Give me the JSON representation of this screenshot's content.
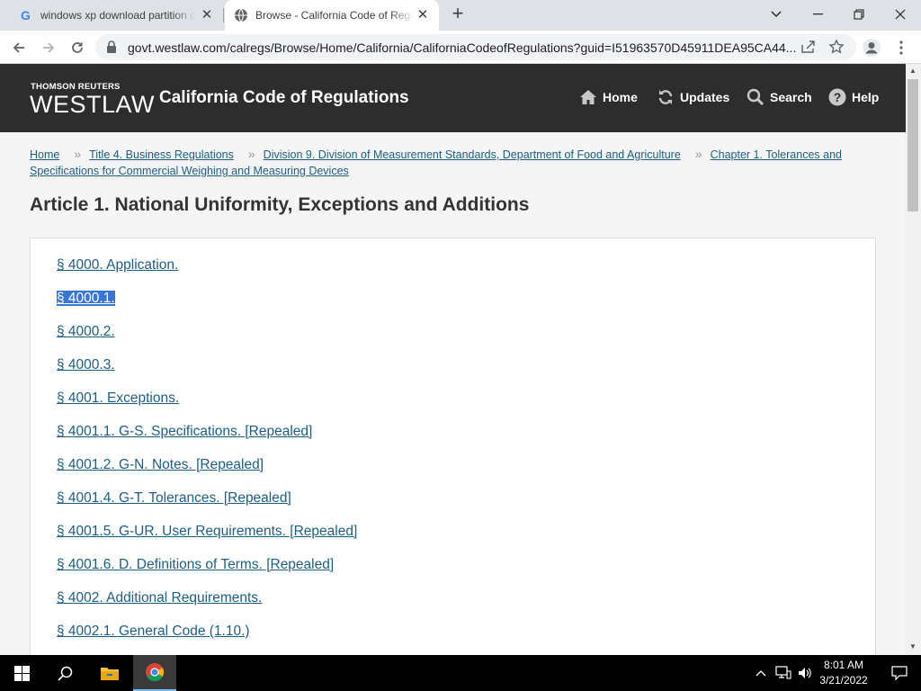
{
  "browser": {
    "tabs": [
      {
        "title": "windows xp download partition cr",
        "favicon": "google-icon",
        "active": false
      },
      {
        "title": "Browse - California Code of Regulations",
        "favicon": "globe-icon",
        "active": true
      }
    ],
    "url": "govt.westlaw.com/calregs/Browse/Home/California/CaliforniaCodeofRegulations?guid=I51963570D45911DEA95CA44..."
  },
  "header": {
    "brand_top": "THOMSON REUTERS",
    "brand_main": "WESTLAW",
    "site_title": "California Code of Regulations",
    "nav": [
      {
        "label": "Home",
        "icon": "home-icon"
      },
      {
        "label": "Updates",
        "icon": "refresh-icon"
      },
      {
        "label": "Search",
        "icon": "search-icon"
      },
      {
        "label": "Help",
        "icon": "help-icon"
      }
    ]
  },
  "breadcrumb": [
    "Home",
    "Title 4. Business Regulations",
    "Division 9. Division of Measurement Standards, Department of Food and Agriculture",
    "Chapter 1. Tolerances and Specifications for Commercial Weighing and Measuring Devices"
  ],
  "article": {
    "title": "Article 1. National Uniformity, Exceptions and Additions",
    "sections": [
      {
        "label": "§ 4000. Application.",
        "selected": false
      },
      {
        "label": "§ 4000.1.",
        "selected": true
      },
      {
        "label": "§ 4000.2.",
        "selected": false
      },
      {
        "label": "§ 4000.3.",
        "selected": false
      },
      {
        "label": "§ 4001. Exceptions.",
        "selected": false
      },
      {
        "label": "§ 4001.1. G-S. Specifications. [Repealed]",
        "selected": false
      },
      {
        "label": "§ 4001.2. G-N. Notes. [Repealed]",
        "selected": false
      },
      {
        "label": "§ 4001.4. G-T. Tolerances. [Repealed]",
        "selected": false
      },
      {
        "label": "§ 4001.5. G-UR. User Requirements. [Repealed]",
        "selected": false
      },
      {
        "label": "§ 4001.6. D. Definitions of Terms. [Repealed]",
        "selected": false
      },
      {
        "label": "§ 4002. Additional Requirements.",
        "selected": false
      },
      {
        "label": "§ 4002.1. General Code (1.10.)",
        "selected": false
      }
    ]
  },
  "taskbar": {
    "time": "8:01 AM",
    "date": "3/21/2022"
  },
  "colors": {
    "link": "#1c5e84",
    "header_bg": "#2d2d2d",
    "selection": "#3875d7"
  }
}
